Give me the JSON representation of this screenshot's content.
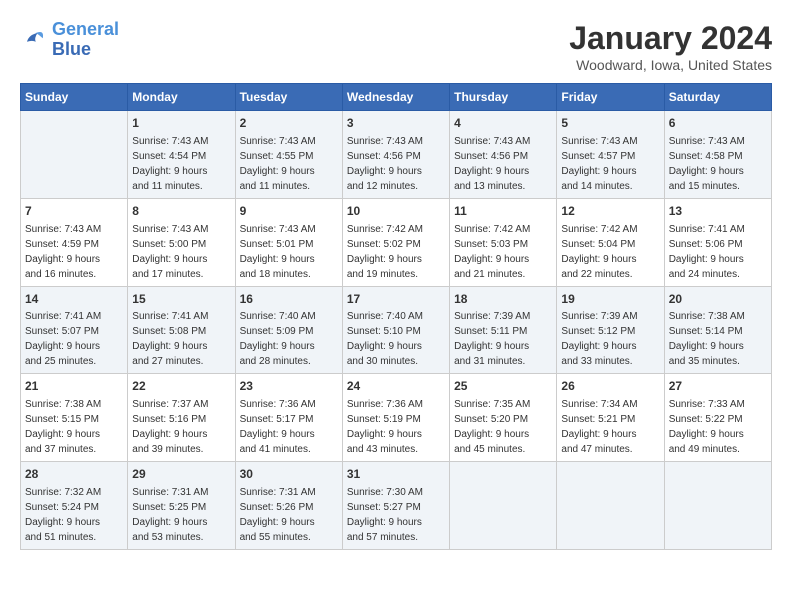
{
  "header": {
    "logo_line1": "General",
    "logo_line2": "Blue",
    "month_title": "January 2024",
    "subtitle": "Woodward, Iowa, United States"
  },
  "days_of_week": [
    "Sunday",
    "Monday",
    "Tuesday",
    "Wednesday",
    "Thursday",
    "Friday",
    "Saturday"
  ],
  "weeks": [
    [
      {
        "day": "",
        "content": ""
      },
      {
        "day": "1",
        "content": "Sunrise: 7:43 AM\nSunset: 4:54 PM\nDaylight: 9 hours\nand 11 minutes."
      },
      {
        "day": "2",
        "content": "Sunrise: 7:43 AM\nSunset: 4:55 PM\nDaylight: 9 hours\nand 11 minutes."
      },
      {
        "day": "3",
        "content": "Sunrise: 7:43 AM\nSunset: 4:56 PM\nDaylight: 9 hours\nand 12 minutes."
      },
      {
        "day": "4",
        "content": "Sunrise: 7:43 AM\nSunset: 4:56 PM\nDaylight: 9 hours\nand 13 minutes."
      },
      {
        "day": "5",
        "content": "Sunrise: 7:43 AM\nSunset: 4:57 PM\nDaylight: 9 hours\nand 14 minutes."
      },
      {
        "day": "6",
        "content": "Sunrise: 7:43 AM\nSunset: 4:58 PM\nDaylight: 9 hours\nand 15 minutes."
      }
    ],
    [
      {
        "day": "7",
        "content": "Sunrise: 7:43 AM\nSunset: 4:59 PM\nDaylight: 9 hours\nand 16 minutes."
      },
      {
        "day": "8",
        "content": "Sunrise: 7:43 AM\nSunset: 5:00 PM\nDaylight: 9 hours\nand 17 minutes."
      },
      {
        "day": "9",
        "content": "Sunrise: 7:43 AM\nSunset: 5:01 PM\nDaylight: 9 hours\nand 18 minutes."
      },
      {
        "day": "10",
        "content": "Sunrise: 7:42 AM\nSunset: 5:02 PM\nDaylight: 9 hours\nand 19 minutes."
      },
      {
        "day": "11",
        "content": "Sunrise: 7:42 AM\nSunset: 5:03 PM\nDaylight: 9 hours\nand 21 minutes."
      },
      {
        "day": "12",
        "content": "Sunrise: 7:42 AM\nSunset: 5:04 PM\nDaylight: 9 hours\nand 22 minutes."
      },
      {
        "day": "13",
        "content": "Sunrise: 7:41 AM\nSunset: 5:06 PM\nDaylight: 9 hours\nand 24 minutes."
      }
    ],
    [
      {
        "day": "14",
        "content": "Sunrise: 7:41 AM\nSunset: 5:07 PM\nDaylight: 9 hours\nand 25 minutes."
      },
      {
        "day": "15",
        "content": "Sunrise: 7:41 AM\nSunset: 5:08 PM\nDaylight: 9 hours\nand 27 minutes."
      },
      {
        "day": "16",
        "content": "Sunrise: 7:40 AM\nSunset: 5:09 PM\nDaylight: 9 hours\nand 28 minutes."
      },
      {
        "day": "17",
        "content": "Sunrise: 7:40 AM\nSunset: 5:10 PM\nDaylight: 9 hours\nand 30 minutes."
      },
      {
        "day": "18",
        "content": "Sunrise: 7:39 AM\nSunset: 5:11 PM\nDaylight: 9 hours\nand 31 minutes."
      },
      {
        "day": "19",
        "content": "Sunrise: 7:39 AM\nSunset: 5:12 PM\nDaylight: 9 hours\nand 33 minutes."
      },
      {
        "day": "20",
        "content": "Sunrise: 7:38 AM\nSunset: 5:14 PM\nDaylight: 9 hours\nand 35 minutes."
      }
    ],
    [
      {
        "day": "21",
        "content": "Sunrise: 7:38 AM\nSunset: 5:15 PM\nDaylight: 9 hours\nand 37 minutes."
      },
      {
        "day": "22",
        "content": "Sunrise: 7:37 AM\nSunset: 5:16 PM\nDaylight: 9 hours\nand 39 minutes."
      },
      {
        "day": "23",
        "content": "Sunrise: 7:36 AM\nSunset: 5:17 PM\nDaylight: 9 hours\nand 41 minutes."
      },
      {
        "day": "24",
        "content": "Sunrise: 7:36 AM\nSunset: 5:19 PM\nDaylight: 9 hours\nand 43 minutes."
      },
      {
        "day": "25",
        "content": "Sunrise: 7:35 AM\nSunset: 5:20 PM\nDaylight: 9 hours\nand 45 minutes."
      },
      {
        "day": "26",
        "content": "Sunrise: 7:34 AM\nSunset: 5:21 PM\nDaylight: 9 hours\nand 47 minutes."
      },
      {
        "day": "27",
        "content": "Sunrise: 7:33 AM\nSunset: 5:22 PM\nDaylight: 9 hours\nand 49 minutes."
      }
    ],
    [
      {
        "day": "28",
        "content": "Sunrise: 7:32 AM\nSunset: 5:24 PM\nDaylight: 9 hours\nand 51 minutes."
      },
      {
        "day": "29",
        "content": "Sunrise: 7:31 AM\nSunset: 5:25 PM\nDaylight: 9 hours\nand 53 minutes."
      },
      {
        "day": "30",
        "content": "Sunrise: 7:31 AM\nSunset: 5:26 PM\nDaylight: 9 hours\nand 55 minutes."
      },
      {
        "day": "31",
        "content": "Sunrise: 7:30 AM\nSunset: 5:27 PM\nDaylight: 9 hours\nand 57 minutes."
      },
      {
        "day": "",
        "content": ""
      },
      {
        "day": "",
        "content": ""
      },
      {
        "day": "",
        "content": ""
      }
    ]
  ]
}
